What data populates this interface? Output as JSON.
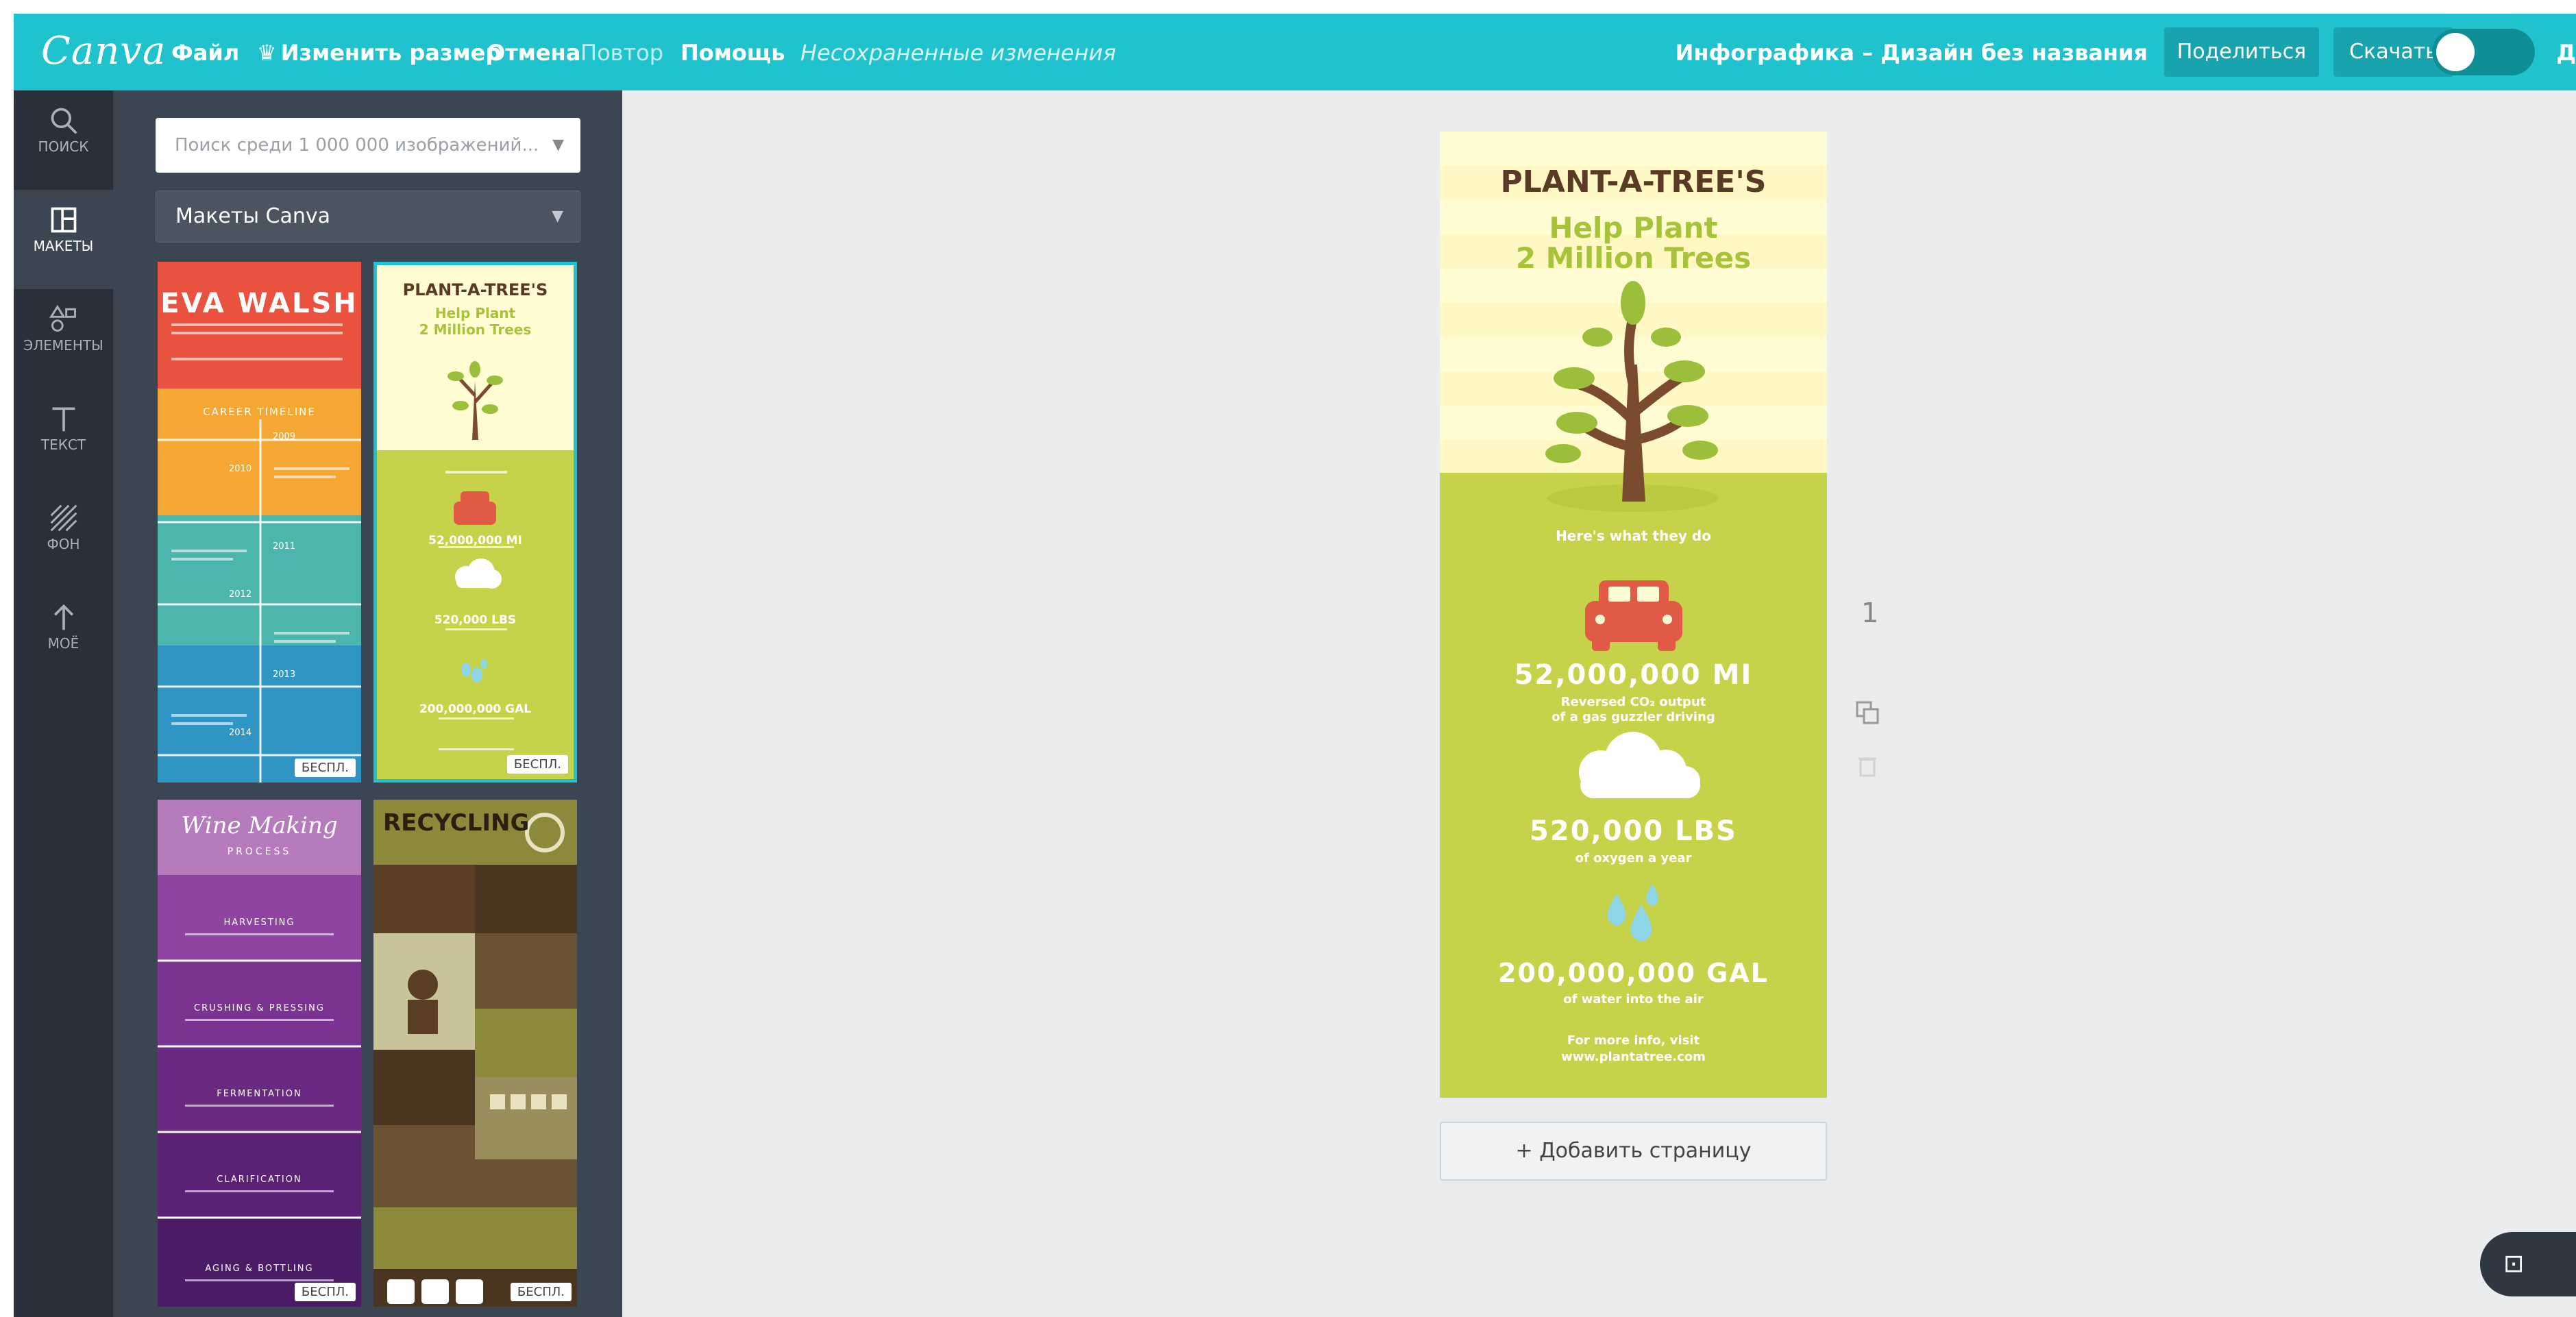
{
  "topbar": {
    "logo": "Canva",
    "file": "Файл",
    "resize": "Изменить размер",
    "undo": "Отмена",
    "redo": "Повтор",
    "help": "Помощь",
    "unsaved": "Несохраненные изменения",
    "doc_title": "Инфографика – Дизайн без названия",
    "share": "Поделиться",
    "download": "Скачать",
    "cut_label": "Д"
  },
  "rail": [
    {
      "label": "ПОИСК",
      "icon": "search-icon"
    },
    {
      "label": "МАКЕТЫ",
      "icon": "layouts-icon"
    },
    {
      "label": "ЭЛЕМЕНТЫ",
      "icon": "elements-icon"
    },
    {
      "label": "ТЕКСТ",
      "icon": "text-icon"
    },
    {
      "label": "ФОН",
      "icon": "background-icon"
    },
    {
      "label": "МОЁ",
      "icon": "upload-icon"
    }
  ],
  "panel": {
    "search_placeholder": "Поиск среди 1 000 000 изображений...",
    "layout_select": "Макеты Canva",
    "free_badge": "БЕСПЛ.",
    "thumbs": {
      "eva": {
        "name": "EVA WALSH",
        "subtitle": "CAREER TIMELINE",
        "years": [
          "2009",
          "2010",
          "2011",
          "2012",
          "2013",
          "2014"
        ]
      },
      "plant": {
        "title": "PLANT-A-TREE'S",
        "subtitle_1": "Help Plant",
        "subtitle_2": "2 Million Trees",
        "stat_1": "52,000,000 MI",
        "stat_2": "520,000 LBS",
        "stat_3": "200,000,000 GAL"
      },
      "wine": {
        "title": "Wine Making",
        "subtitle": "PROCESS",
        "steps": [
          "HARVESTING",
          "CRUSHING & PRESSING",
          "FERMENTATION",
          "CLARIFICATION",
          "AGING & BOTTLING"
        ]
      },
      "recycling": {
        "title": "RECYCLING"
      }
    }
  },
  "page": {
    "title": "PLANT-A-TREE'S",
    "subtitle_1": "Help Plant",
    "subtitle_2": "2 Million Trees",
    "intro": "Here's what they do",
    "stat_1": "52,000,000 MI",
    "stat_1_caption_1": "Reversed CO₂ output",
    "stat_1_caption_2": "of a gas guzzler driving",
    "stat_2": "520,000 LBS",
    "stat_2_caption": "of oxygen a year",
    "stat_3": "200,000,000 GAL",
    "stat_3_caption": "of water into the air",
    "footer_1": "For more info, visit",
    "footer_2": "www.plantatree.com"
  },
  "page_number": "1",
  "add_page": "+ Добавить страницу",
  "colors": {
    "topbar": "#20c3cd",
    "rail": "#293039",
    "panel": "#3c4652",
    "canvas_bg": "#ebecee",
    "page_green": "#c6d34a",
    "page_cream": "#fffbd2",
    "title_brown": "#5b3a25",
    "subtitle_green": "#a6c33a",
    "car_red": "#e05a45",
    "drop_blue": "#8fd7e8"
  }
}
